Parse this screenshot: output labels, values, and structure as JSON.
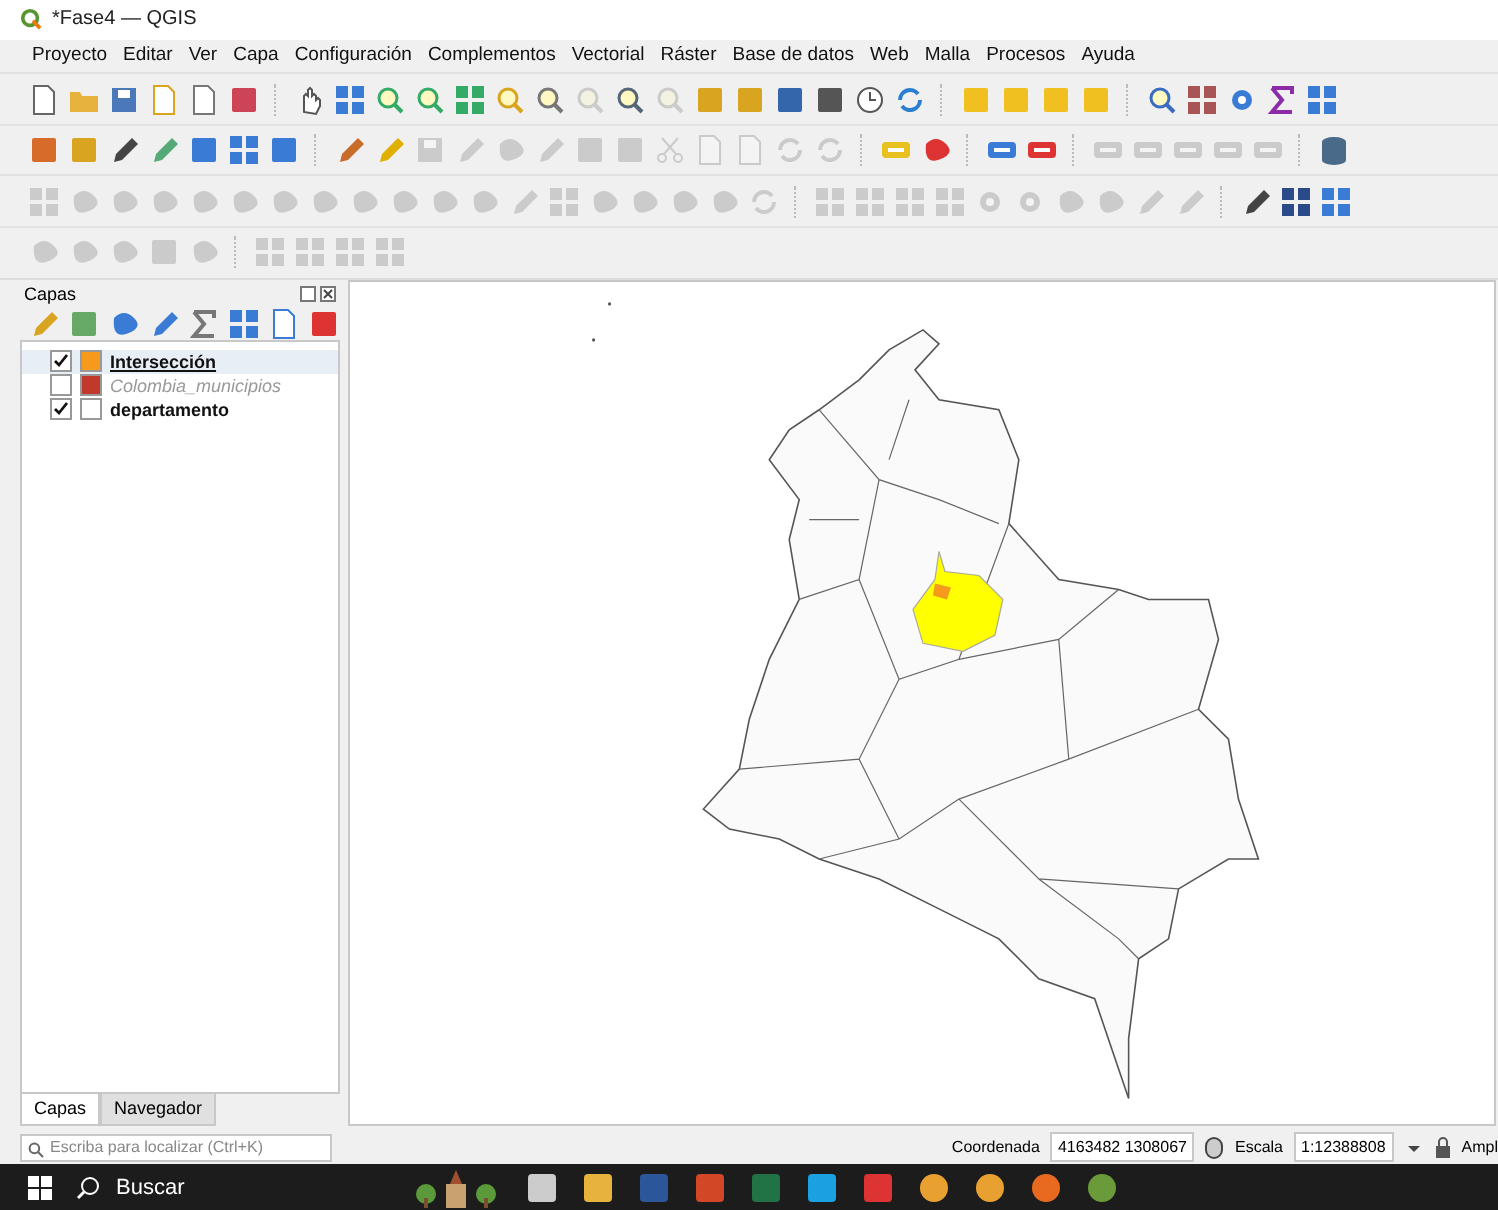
{
  "window": {
    "title": "*Fase4 — QGIS"
  },
  "menu": [
    "Proyecto",
    "Editar",
    "Ver",
    "Capa",
    "Configuración",
    "Complementos",
    "Vectorial",
    "Ráster",
    "Base de datos",
    "Web",
    "Malla",
    "Procesos",
    "Ayuda"
  ],
  "layers_panel": {
    "title": "Capas",
    "layers": [
      {
        "name": "Intersección",
        "checked": true,
        "selected": true,
        "disabled": false,
        "color": "#f59a1c"
      },
      {
        "name": "Colombia_municipios",
        "checked": false,
        "selected": false,
        "disabled": true,
        "color": "#c0392b"
      },
      {
        "name": "departamento",
        "checked": true,
        "selected": false,
        "disabled": false,
        "color": "#ffffff"
      }
    ],
    "tabs": [
      {
        "label": "Capas",
        "selected": true
      },
      {
        "label": "Navegador",
        "selected": false
      }
    ]
  },
  "locator": {
    "placeholder": "Escriba para localizar (Ctrl+K)"
  },
  "status_bar": {
    "coord_label": "Coordenada",
    "coord_value": "4163482 1308067",
    "scale_label": "Escala",
    "scale_value": "1:12388808",
    "render_label": "Ampl"
  },
  "taskbar": {
    "search": "Buscar"
  }
}
